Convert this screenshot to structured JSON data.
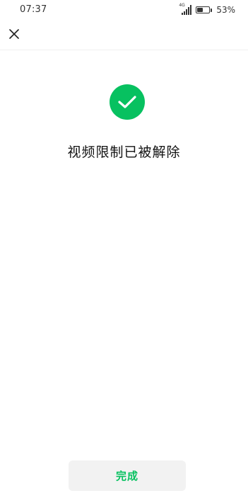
{
  "status_bar": {
    "time": "07:37",
    "network": "4G",
    "battery_percent_text": "53%",
    "battery_level": 0.53
  },
  "result": {
    "title": "视频限制已被解除"
  },
  "footer": {
    "done_label": "完成"
  },
  "colors": {
    "accent": "#07c160",
    "button_bg": "#f2f2f2",
    "text": "#111111"
  }
}
